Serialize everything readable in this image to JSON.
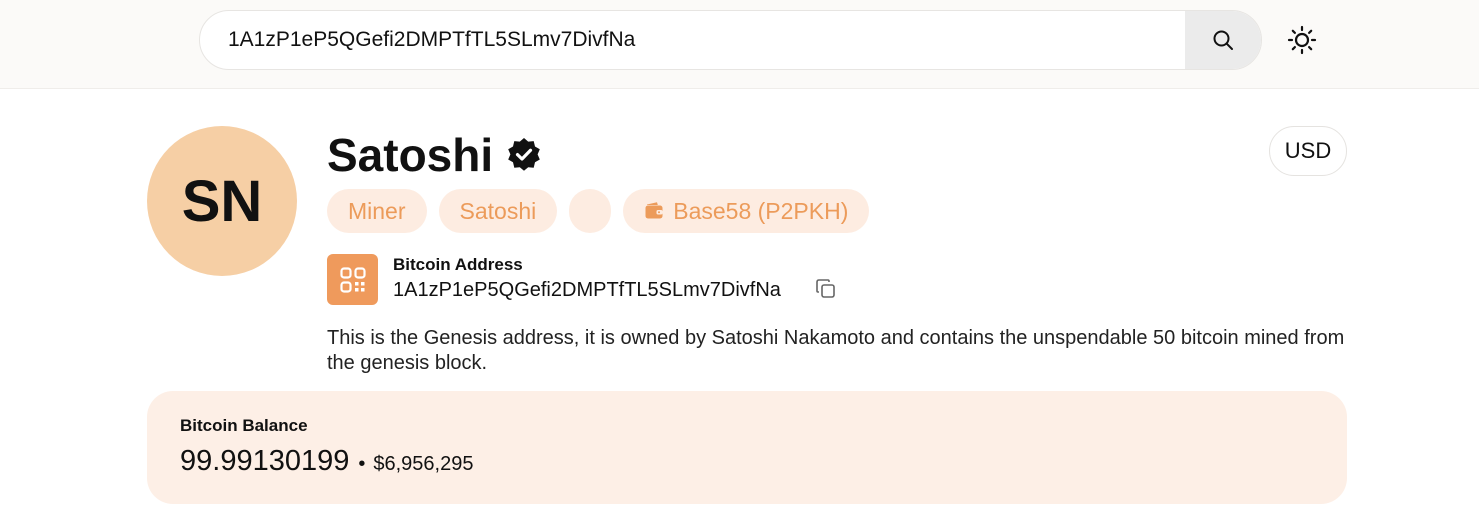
{
  "search": {
    "value": "1A1zP1eP5QGefi2DMPTfTL5SLmv7DivfNa"
  },
  "icons": {
    "search": "search-icon",
    "theme": "sun-icon",
    "verified": "verified-badge-icon",
    "wallet": "wallet-icon",
    "qr": "qr-code-icon",
    "copy": "copy-icon"
  },
  "profile": {
    "initials": "SN",
    "name": "Satoshi",
    "currency": "USD",
    "tags": [
      {
        "label": "Miner"
      },
      {
        "label": "Satoshi"
      },
      {
        "label": ""
      },
      {
        "label": "Base58 (P2PKH)"
      }
    ],
    "address_label": "Bitcoin Address",
    "address": "1A1zP1eP5QGefi2DMPTfTL5SLmv7DivfNa",
    "description": "This is the Genesis address, it is owned by Satoshi Nakamoto and contains the unspendable 50 bitcoin mined from the genesis block."
  },
  "balance": {
    "label": "Bitcoin Balance",
    "btc": "99.99130199",
    "separator": "•",
    "usd": "$6,956,295"
  },
  "colors": {
    "accent": "#ef9a5c",
    "avatar_bg": "#f6cfa5",
    "tag_bg": "#fdece1",
    "tag_text": "#ec9b5a",
    "balance_bg": "#fdefe6"
  }
}
